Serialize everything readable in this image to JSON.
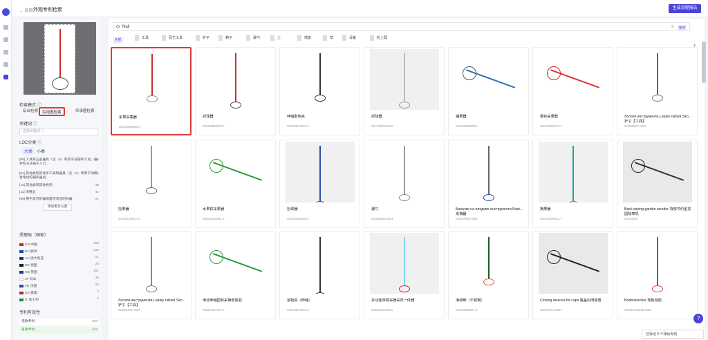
{
  "header": {
    "back": "← 返回",
    "title": "外观专利检索",
    "generate": "生成流程报告"
  },
  "left": {
    "mode_label": "检索模式 ⓘ",
    "modes": [
      "综合检索",
      "实用图检索",
      "传承图检索"
    ],
    "keyword_label": "关键词 ⓘ",
    "keyword_placeholder": "选择关键词 ⓘ",
    "loc_label": "LOC分类 ⓘ",
    "loc_tabs": [
      "大类",
      "小类"
    ],
    "loc_items": [
      {
        "text": "[08] 工具和五金器具（注（a）和原子设部件工具，器材和方式被于人力...",
        "n": "324"
      },
      {
        "text": "[01] 其他类和其他手工具和器具（注（a）和原子动或者电动的摄影器具...",
        "n": "104"
      },
      {
        "text": "[10] 其他类和其他机构",
        "n": "38"
      },
      {
        "text": "[11] 饰用品",
        "n": "41"
      },
      {
        "text": "[99] 用于清洁的器或是积清洁的机器",
        "n": "21"
      }
    ],
    "more": "添加更多分类",
    "country_label": "受理局（国家）",
    "countries": [
      {
        "name": "CN 中国",
        "n": "453",
        "color": "#d7261e"
      },
      {
        "name": "EU 欧洲",
        "n": "144",
        "color": "#2a4aa8"
      },
      {
        "name": "AU 澳大利亚",
        "n": "21",
        "color": "#1f3a8a"
      },
      {
        "name": "DE 德国",
        "n": "25",
        "color": "#222"
      },
      {
        "name": "GB 英国",
        "n": "161",
        "color": "#1f3a8a"
      },
      {
        "name": "JP 日本",
        "n": "38",
        "color": "#fff"
      },
      {
        "name": "FR 法国",
        "n": "26",
        "color": "#2a4aa8"
      },
      {
        "name": "US 美国",
        "n": "2",
        "color": "#b22"
      },
      {
        "name": "IT 意大利",
        "n": "2",
        "color": "#1a8a3a"
      }
    ],
    "validity_label": "专利有效性",
    "validity": [
      {
        "name": "无效专利",
        "n": "303"
      },
      {
        "name": "有效专利",
        "n": "497"
      }
    ]
  },
  "main": {
    "query": "Nail",
    "clear": "⊗",
    "search_btn": "搜索",
    "all": "全部",
    "filters": [
      "工具",
      "园艺工具",
      "铲子",
      "耙子",
      "漏勺",
      "土",
      "插座",
      "草",
      "设备",
      "粒土器"
    ],
    "cards": [
      {
        "name": "采果采集器",
        "num": "201430690590.1"
      },
      {
        "name": "抓球器",
        "num": "301930802537.0"
      },
      {
        "name": "伸缩取物夹",
        "num": "202030672330.X"
      },
      {
        "name": "抓球器",
        "num": "301730366036.5"
      },
      {
        "name": "捕果器",
        "num": "201430356538.6"
      },
      {
        "name": "钢丝采果器",
        "num": "302130066179.1"
      },
      {
        "name": "Лопати инструменти,Lopaty nářadí,Sko... 铲子【工具】",
        "num": "019630557-0001"
      },
      {
        "name": "捡果器",
        "num": "202330379417.9"
      },
      {
        "name": "水果铁采果器",
        "num": "202030264461.3"
      },
      {
        "name": "捡球器",
        "num": "201930136039.0"
      },
      {
        "name": "漏勺",
        "num": "201630291209.4"
      },
      {
        "name": "Берачки на плодове инструменти,Nast... 采摘器",
        "num": "015007863-0001"
      },
      {
        "name": "摘果器",
        "num": "202230397612.7"
      },
      {
        "name": "Back saving garden weeder 背部节约型花园除草机",
        "num": "29C8320d"
      },
      {
        "name": "Лопати инструменти,Lopaty nářadí,Sko... 铲子【工具】",
        "num": "015591451-0003"
      },
      {
        "name": "电动伸缩园林采摘收集机",
        "num": "202230417577.0"
      },
      {
        "name": "拾物夹（伸缩）",
        "num": "202230571653.8"
      },
      {
        "name": "多功能林荫采摘采风一体器",
        "num": "202230234702.x"
      },
      {
        "name": "海绵刷（不锈钢）",
        "num": "201430509671.3"
      },
      {
        "name": "Closing devices for caps 瓶盖封闭装置",
        "num": "047937644-0001"
      },
      {
        "name": "Bodenelscher 地板泡柜",
        "num": "402019106435-0005"
      }
    ]
  },
  "footer": {
    "help": "?",
    "note": "已标记 0 个相似专利"
  }
}
